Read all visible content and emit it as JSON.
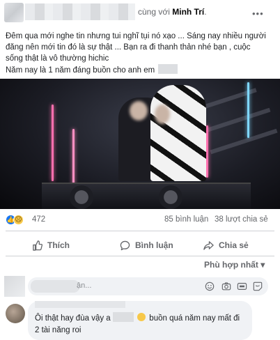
{
  "post": {
    "with_prefix": "cùng với",
    "tagged_name": "Minh Trí",
    "more_label": "•••",
    "text_lines": [
      "Đêm qua mới nghe tin nhưng tui nghĩ tụi nó xạo ... Sáng nay nhiều người",
      "đăng nên mới tin đó là sự thật ... Bạn ra đi thanh thản nhé bạn , cuộc",
      "sống thật là vô thường hichic",
      "Năm nay là 1 năm đáng buồn cho anh em"
    ]
  },
  "stats": {
    "reaction_count": "472",
    "comments": "85 bình luận",
    "shares": "38 lượt chia sẻ"
  },
  "actions": {
    "like": "Thích",
    "comment": "Bình luận",
    "share": "Chia sẻ"
  },
  "sort": {
    "label": "Phù hợp nhất",
    "chevron": "▾"
  },
  "composer": {
    "placeholder_fragment": "ận..."
  },
  "comment": {
    "text_part1": "Ôi thật hay đùa vậy a",
    "text_part2": "buồn quá năm nay mất đi",
    "text_line2": "2 tài năng roi"
  },
  "colors": {
    "link_blue": "#1877f2",
    "muted": "#65676b",
    "bubble": "#f0f2f5"
  }
}
